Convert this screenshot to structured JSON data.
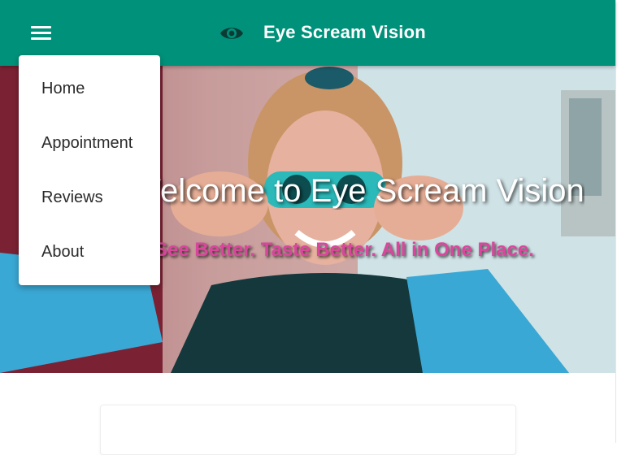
{
  "app": {
    "title": "Eye Scream Vision",
    "brand_color": "#00917a"
  },
  "icons": {
    "menu": "hamburger-menu-icon",
    "brand": "eye-icon"
  },
  "menu": {
    "items": [
      {
        "label": "Home"
      },
      {
        "label": "Appointment"
      },
      {
        "label": "Reviews"
      },
      {
        "label": "About"
      }
    ]
  },
  "hero": {
    "title": "Welcome to Eye Scream Vision",
    "subtitle": "See Better. Taste Better. All in One Place.",
    "subtitle_color": "#d9479d"
  }
}
